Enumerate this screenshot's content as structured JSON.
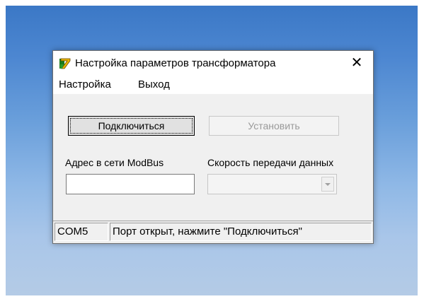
{
  "window": {
    "title": "Настройка параметров трансформатора",
    "close_glyph": "✕"
  },
  "menu": {
    "items": [
      {
        "label": "Настройка"
      },
      {
        "label": "Выход"
      }
    ]
  },
  "buttons": {
    "connect_label": "Подключиться",
    "set_label": "Установить"
  },
  "fields": {
    "modbus_address": {
      "label": "Адрес в сети ModBus",
      "value": ""
    },
    "baud_rate": {
      "label": "Скорость передачи данных",
      "value": ""
    }
  },
  "status": {
    "port": "COM5",
    "message": "Порт открыт, нажмите \"Подключиться\""
  },
  "icons": {
    "app": "app-icon",
    "close": "close-icon",
    "dropdown": "chevron-down-icon"
  },
  "colors": {
    "desktop_top": "#3b78c6",
    "desktop_bottom": "#b4cbe6",
    "window_bg": "#f0f0f0",
    "disabled_text": "#9a9a9a"
  }
}
